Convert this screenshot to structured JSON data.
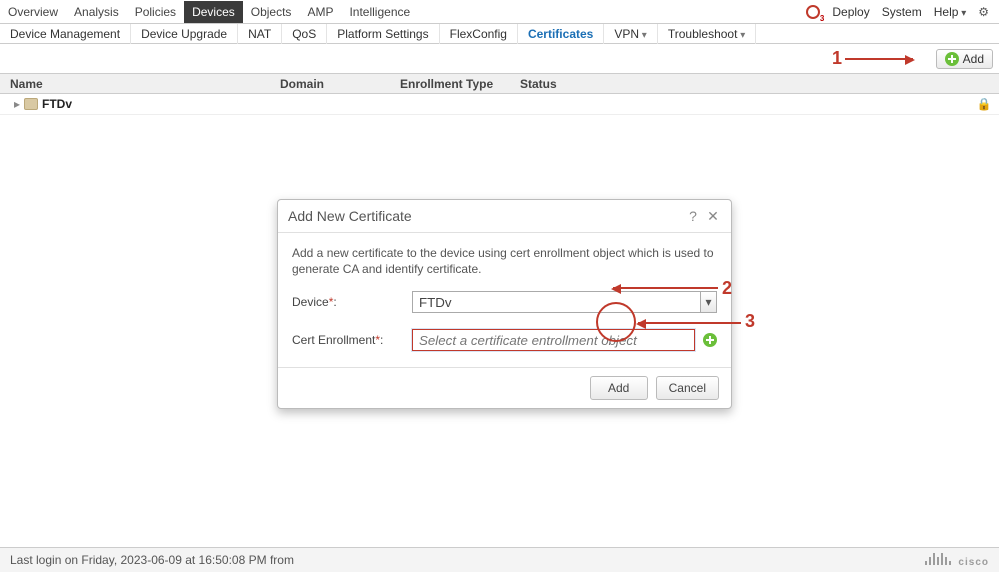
{
  "topnav": {
    "items": [
      "Overview",
      "Analysis",
      "Policies",
      "Devices",
      "Objects",
      "AMP",
      "Intelligence"
    ],
    "active_index": 3,
    "deploy_badge": "3",
    "right": {
      "deploy": "Deploy",
      "system": "System",
      "help": "Help"
    }
  },
  "subnav": {
    "items": [
      "Device Management",
      "Device Upgrade",
      "NAT",
      "QoS",
      "Platform Settings",
      "FlexConfig",
      "Certificates",
      "VPN",
      "Troubleshoot"
    ],
    "active_index": 6,
    "dropdown_indices": [
      7,
      8
    ]
  },
  "toolbar": {
    "add_label": "Add"
  },
  "table": {
    "headers": {
      "name": "Name",
      "domain": "Domain",
      "enroll": "Enrollment Type",
      "status": "Status"
    },
    "rows": [
      {
        "name": "FTDv",
        "domain": "",
        "enroll": "",
        "status": "",
        "locked": true
      }
    ]
  },
  "callouts": {
    "one": "1",
    "two": "2",
    "three": "3"
  },
  "modal": {
    "title": "Add New Certificate",
    "description": "Add a new certificate to the device using cert enrollment object which is used to generate CA and identify certificate.",
    "device_label": "Device",
    "device_value": "FTDv",
    "cert_label": "Cert Enrollment",
    "cert_placeholder": "Select a certificate entrollment object",
    "add_label": "Add",
    "cancel_label": "Cancel"
  },
  "footer": {
    "last_login": "Last login on Friday, 2023-06-09 at 16:50:08 PM from",
    "brand": "cisco"
  },
  "icons": {
    "deploy": "deploy-icon",
    "gear": "gear-icon",
    "help": "help-icon",
    "close": "close-icon",
    "lock": "lock-icon",
    "plus": "plus-icon",
    "add_enroll": "add-enrollment-icon",
    "chevron": "chevron-down-icon"
  }
}
